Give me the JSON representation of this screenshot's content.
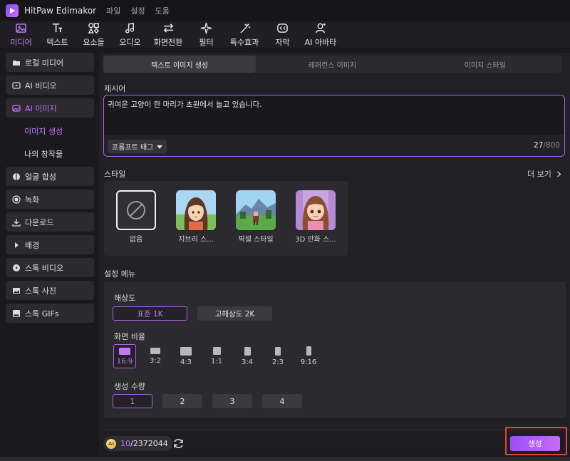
{
  "app": {
    "title": "HitPaw Edimakor",
    "menu": [
      "파일",
      "설정",
      "도움"
    ]
  },
  "toolbar": {
    "items": [
      {
        "label": "미디어",
        "icon": "media-icon",
        "active": true
      },
      {
        "label": "텍스트",
        "icon": "text-icon"
      },
      {
        "label": "요소들",
        "icon": "elements-icon"
      },
      {
        "label": "오디오",
        "icon": "music-note-icon"
      },
      {
        "label": "화면전환",
        "icon": "transition-icon"
      },
      {
        "label": "필터",
        "icon": "sparkle-icon"
      },
      {
        "label": "특수효과",
        "icon": "wand-icon"
      },
      {
        "label": "자막",
        "icon": "caption-icon"
      },
      {
        "label": "AI 아바타",
        "icon": "avatar-icon"
      }
    ]
  },
  "sidebar": {
    "items": [
      {
        "label": "로컬 미디어",
        "icon": "folder-icon"
      },
      {
        "label": "AI 비디오",
        "icon": "ai-video-icon"
      },
      {
        "label": "AI 이미지",
        "icon": "ai-image-icon",
        "active": true
      },
      {
        "label": "이미지 생성",
        "sub": true,
        "active": true
      },
      {
        "label": "나의 창작물",
        "sub": true
      },
      {
        "label": "얼굴 합성",
        "icon": "face-swap-icon"
      },
      {
        "label": "녹화",
        "icon": "record-icon"
      },
      {
        "label": "다운로드",
        "icon": "download-icon"
      },
      {
        "label": "배경",
        "icon": "caret-right-icon"
      },
      {
        "label": "스톡 비디오",
        "icon": "stock-video-icon"
      },
      {
        "label": "스톡 사진",
        "icon": "stock-photo-icon"
      },
      {
        "label": "스톡 GIFs",
        "icon": "gif-icon"
      }
    ]
  },
  "tabs": [
    "텍스트 이미지 생성",
    "레퍼런스 이미지",
    "이미지 스타일"
  ],
  "prompt": {
    "label": "제시어",
    "text": "귀여운 고양이 한 마리가 초원에서 놀고 있습니다.",
    "tag_button": "프롬프트 태그",
    "count": "27",
    "max": "/800"
  },
  "style": {
    "label": "스타일",
    "more": "더 보기",
    "options": [
      {
        "name": "없음",
        "selected": true
      },
      {
        "name": "지브리 스..."
      },
      {
        "name": "픽셀 스타일"
      },
      {
        "name": "3D 만화 스..."
      }
    ]
  },
  "settings": {
    "label": "설정 메뉴",
    "resolution_label": "해상도",
    "resolutions": [
      {
        "label": "표준 1K",
        "active": true
      },
      {
        "label": "고해상도 2K"
      }
    ],
    "ratio_label": "화면 비율",
    "ratios": [
      "16:9",
      "3:2",
      "4:3",
      "1:1",
      "3:4",
      "2:3",
      "9:16"
    ],
    "ratio_active": "16:9",
    "count_label": "생성 수량",
    "counts": [
      "1",
      "2",
      "3",
      "4"
    ],
    "count_active": "1"
  },
  "footer": {
    "credits_used": "10",
    "credits_total": "/2372044",
    "coin_text": "AI",
    "generate": "생성"
  },
  "colors": {
    "accent": "#c278ff",
    "accent_border": "#b45ee8",
    "highlight_outline": "#e0443b",
    "background": "#1a1a1d",
    "panel": "#2a2a2f"
  }
}
